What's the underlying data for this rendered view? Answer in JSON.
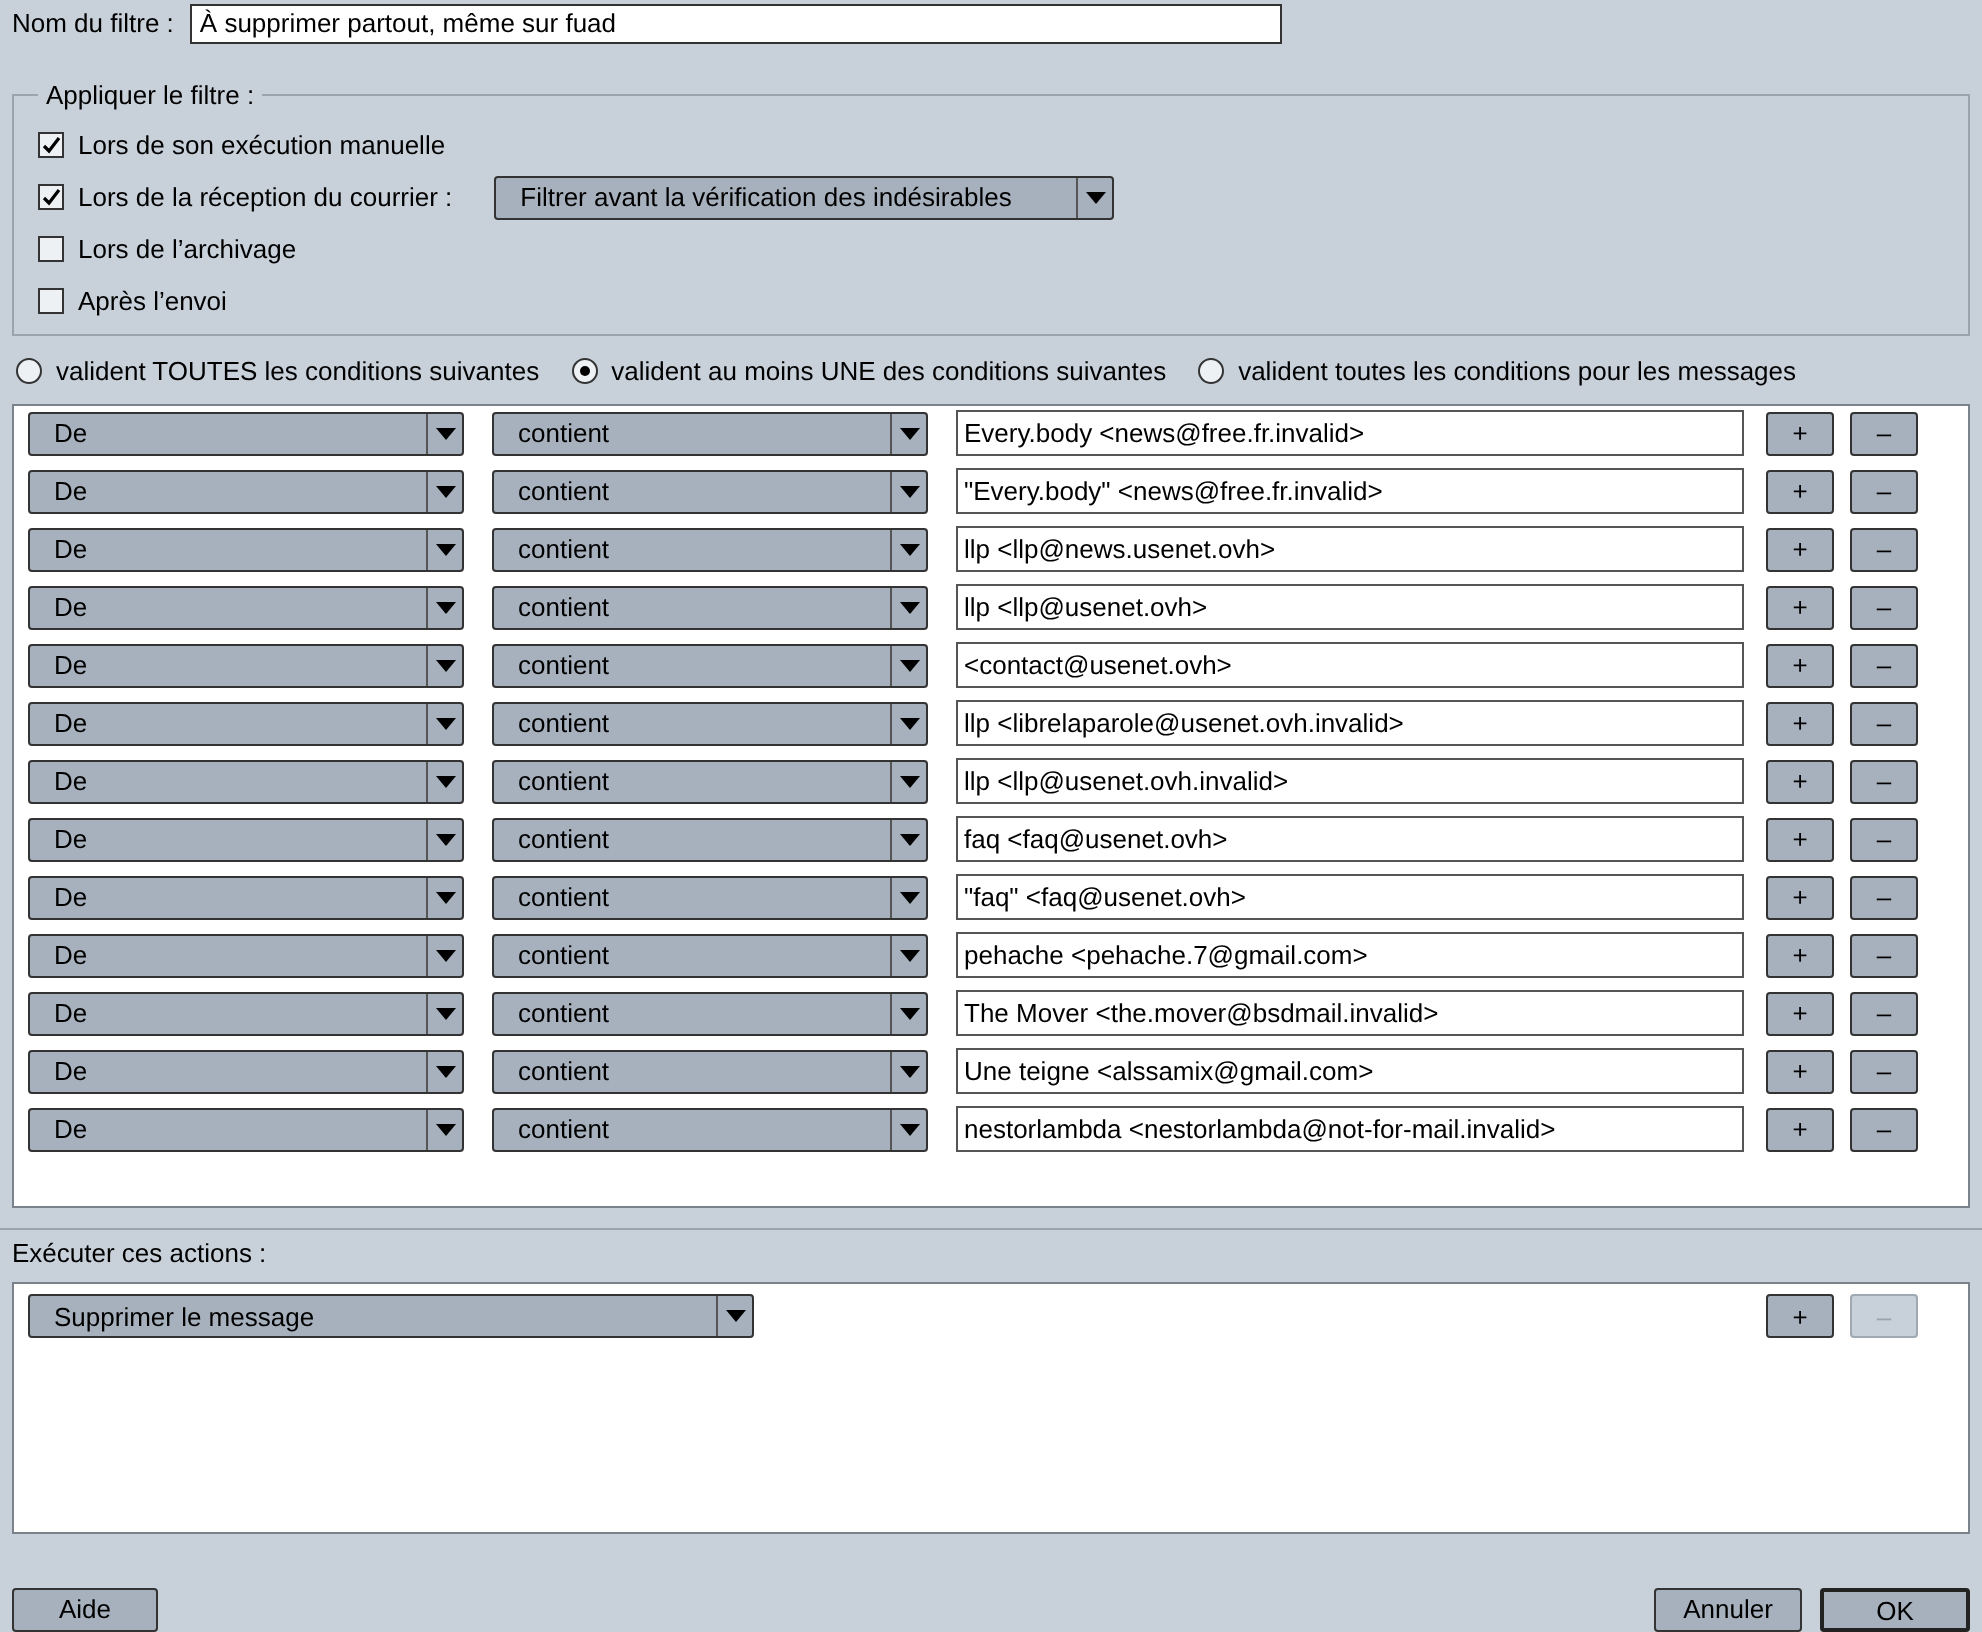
{
  "filter_name": {
    "label": "Nom du filtre :",
    "value": "À supprimer partout, même sur fuad"
  },
  "apply": {
    "legend": "Appliquer le filtre :",
    "options": [
      {
        "label": "Lors de son exécution manuelle",
        "checked": true
      },
      {
        "label": "Lors de la réception du courrier :",
        "checked": true,
        "dropdown": "Filtrer avant la vérification des indésirables"
      },
      {
        "label": "Lors de l’archivage",
        "checked": false
      },
      {
        "label": "Après l’envoi",
        "checked": false
      }
    ]
  },
  "match": [
    {
      "label": "valident TOUTES les conditions suivantes",
      "selected": false
    },
    {
      "label": "valident au moins UNE des conditions suivantes",
      "selected": true
    },
    {
      "label": "valident toutes les conditions pour les messages",
      "selected": false
    }
  ],
  "conditions": [
    {
      "field": "De",
      "operator": "contient",
      "value": "Every.body <news@free.fr.invalid>"
    },
    {
      "field": "De",
      "operator": "contient",
      "value": "\"Every.body\" <news@free.fr.invalid>"
    },
    {
      "field": "De",
      "operator": "contient",
      "value": "llp <llp@news.usenet.ovh>"
    },
    {
      "field": "De",
      "operator": "contient",
      "value": "llp <llp@usenet.ovh>"
    },
    {
      "field": "De",
      "operator": "contient",
      "value": "<contact@usenet.ovh>"
    },
    {
      "field": "De",
      "operator": "contient",
      "value": "llp <librelaparole@usenet.ovh.invalid>"
    },
    {
      "field": "De",
      "operator": "contient",
      "value": "llp <llp@usenet.ovh.invalid>"
    },
    {
      "field": "De",
      "operator": "contient",
      "value": "faq <faq@usenet.ovh>"
    },
    {
      "field": "De",
      "operator": "contient",
      "value": "\"faq\" <faq@usenet.ovh>"
    },
    {
      "field": "De",
      "operator": "contient",
      "value": "pehache <pehache.7@gmail.com>"
    },
    {
      "field": "De",
      "operator": "contient",
      "value": "The Mover <the.mover@bsdmail.invalid>"
    },
    {
      "field": "De",
      "operator": "contient",
      "value": "Une teigne <alssamix@gmail.com>"
    },
    {
      "field": "De",
      "operator": "contient",
      "value": "nestorlambda <nestorlambda@not-for-mail.invalid>"
    }
  ],
  "row_buttons": {
    "add": "+",
    "remove": "–"
  },
  "actions": {
    "label": "Exécuter ces actions :",
    "items": [
      {
        "action": "Supprimer le message",
        "remove_disabled": true
      }
    ]
  },
  "footer": {
    "help": "Aide",
    "cancel": "Annuler",
    "ok": "OK"
  }
}
